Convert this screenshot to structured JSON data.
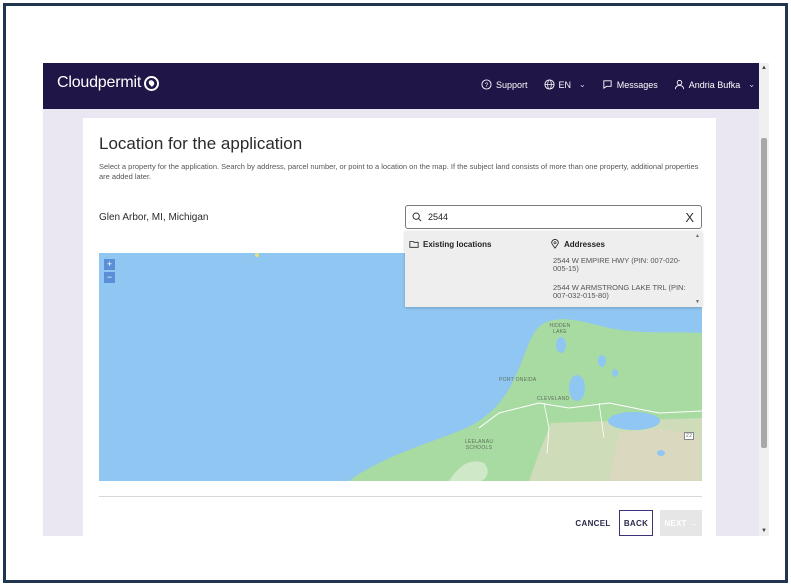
{
  "header": {
    "brand": "Cloudpermit",
    "support": "Support",
    "language": "EN",
    "messages": "Messages",
    "user": "Andria Bufka"
  },
  "page": {
    "title": "Location for the application",
    "description": "Select a property for the application. Search by address, parcel number, or point to a location on the map. If the subject land consists of more than one property, additional properties are added later.",
    "place": "Glen Arbor, MI, Michigan"
  },
  "search": {
    "value": "2544",
    "clear": "X"
  },
  "dropdown": {
    "existing_header": "Existing locations",
    "addresses_header": "Addresses",
    "addresses": [
      "2544 W EMPIRE HWY (PIN: 007-020-005-15)",
      "2544 W ARMSTRONG LAKE TRL (PIN: 007-032-015-80)"
    ]
  },
  "map": {
    "zoom_in": "+",
    "zoom_out": "−",
    "labels": [
      "PORT ONEIDA",
      "CLEVELAND",
      "LEELANAU SCHOOLS",
      "HIDDEN LAKE",
      "22"
    ]
  },
  "actions": {
    "cancel": "CANCEL",
    "back": "BACK",
    "next": "NEXT →"
  },
  "colors": {
    "header_bg": "#1f1547",
    "water": "#8fc6f2",
    "land": "#a8dba1",
    "accent": "#3d2f7a"
  }
}
